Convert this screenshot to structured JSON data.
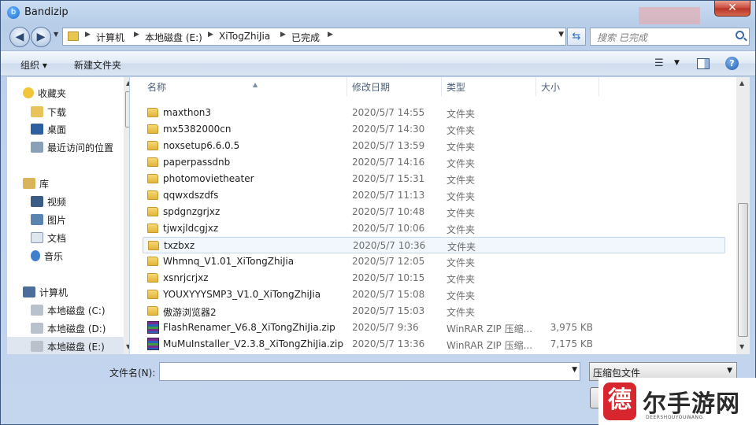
{
  "window": {
    "title": "Bandizip",
    "close_glyph": "✕"
  },
  "address": {
    "crumbs": [
      "计算机",
      "本地磁盘 (E:)",
      "XiTogZhiJia",
      "已完成"
    ],
    "search_placeholder": "搜索 已完成"
  },
  "toolbar": {
    "organize": "组织 ▾",
    "new_folder": "新建文件夹"
  },
  "nav": {
    "favorites": "收藏夹",
    "favorites_items": [
      "下载",
      "桌面",
      "最近访问的位置"
    ],
    "libraries": "库",
    "library_items": [
      "视频",
      "图片",
      "文档",
      "音乐"
    ],
    "computer": "计算机",
    "drives": [
      "本地磁盘 (C:)",
      "本地磁盘 (D:)",
      "本地磁盘 (E:)"
    ]
  },
  "columns": {
    "name": "名称",
    "date": "修改日期",
    "type": "类型",
    "size": "大小"
  },
  "files": [
    {
      "name": "maxthon3",
      "date": "2020/5/7 14:55",
      "type": "文件夹",
      "size": "",
      "kind": "folder"
    },
    {
      "name": "mx5382000cn",
      "date": "2020/5/7 14:30",
      "type": "文件夹",
      "size": "",
      "kind": "folder"
    },
    {
      "name": "noxsetup6.6.0.5",
      "date": "2020/5/7 13:59",
      "type": "文件夹",
      "size": "",
      "kind": "folder"
    },
    {
      "name": "paperpassdnb",
      "date": "2020/5/7 14:16",
      "type": "文件夹",
      "size": "",
      "kind": "folder"
    },
    {
      "name": "photomovietheater",
      "date": "2020/5/7 15:31",
      "type": "文件夹",
      "size": "",
      "kind": "folder"
    },
    {
      "name": "qqwxdszdfs",
      "date": "2020/5/7 11:13",
      "type": "文件夹",
      "size": "",
      "kind": "folder"
    },
    {
      "name": "spdgnzgrjxz",
      "date": "2020/5/7 10:48",
      "type": "文件夹",
      "size": "",
      "kind": "folder"
    },
    {
      "name": "tjwxjldcgjxz",
      "date": "2020/5/7 10:06",
      "type": "文件夹",
      "size": "",
      "kind": "folder"
    },
    {
      "name": "txzbxz",
      "date": "2020/5/7 10:36",
      "type": "文件夹",
      "size": "",
      "kind": "folder"
    },
    {
      "name": "Whmnq_V1.01_XiTongZhiJia",
      "date": "2020/5/7 12:05",
      "type": "文件夹",
      "size": "",
      "kind": "folder"
    },
    {
      "name": "xsnrjcrjxz",
      "date": "2020/5/7 10:15",
      "type": "文件夹",
      "size": "",
      "kind": "folder"
    },
    {
      "name": "YOUXYYYSMP3_V1.0_XiTongZhiJia",
      "date": "2020/5/7 15:08",
      "type": "文件夹",
      "size": "",
      "kind": "folder"
    },
    {
      "name": "傲游浏览器2",
      "date": "2020/5/7 15:03",
      "type": "文件夹",
      "size": "",
      "kind": "folder"
    },
    {
      "name": "FlashRenamer_V6.8_XiTongZhiJia.zip",
      "date": "2020/5/7 9:36",
      "type": "WinRAR ZIP 压缩...",
      "size": "3,975 KB",
      "kind": "zip"
    },
    {
      "name": "MuMuInstaller_V2.3.8_XiTongZhiJia.zip",
      "date": "2020/5/7 13:36",
      "type": "WinRAR ZIP 压缩...",
      "size": "7,175 KB",
      "kind": "zip"
    }
  ],
  "bottom": {
    "filename_label": "文件名(N):",
    "filename_value": "",
    "filetype": "压缩包文件"
  },
  "watermark": {
    "seal": "德",
    "text": "尔手游网",
    "sub": "DEERSHOUYOUWANG"
  }
}
